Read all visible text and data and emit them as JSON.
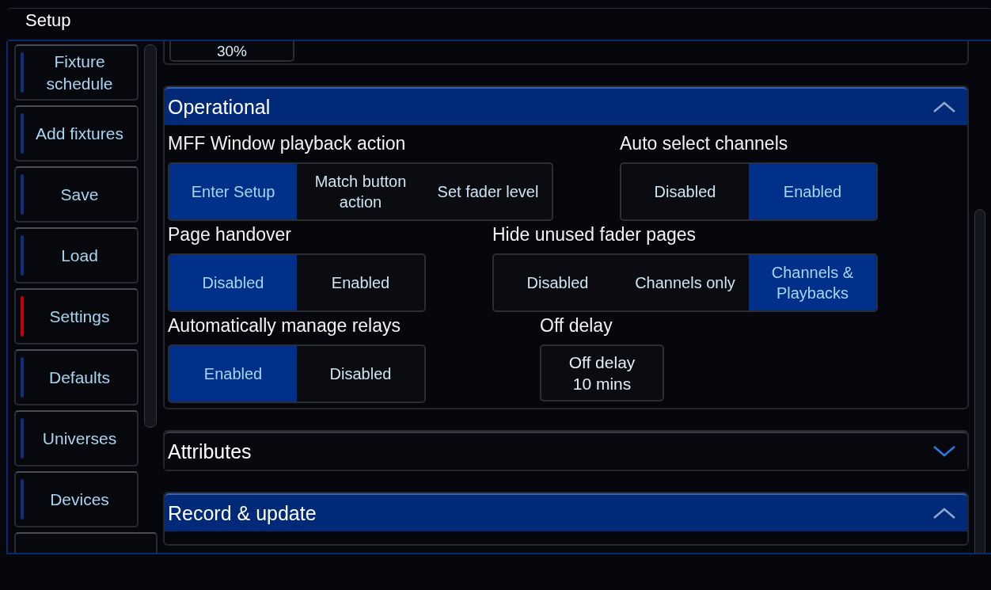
{
  "window": {
    "title": "Setup"
  },
  "sidebar": {
    "items": [
      {
        "label": "Fixture schedule",
        "selected": false
      },
      {
        "label": "Add fixtures",
        "selected": false
      },
      {
        "label": "Save",
        "selected": false
      },
      {
        "label": "Load",
        "selected": false
      },
      {
        "label": "Settings",
        "selected": true
      },
      {
        "label": "Defaults",
        "selected": false
      },
      {
        "label": "Universes",
        "selected": false
      },
      {
        "label": "Devices",
        "selected": false
      }
    ]
  },
  "sections": [
    {
      "kind": "partial",
      "value_button": "30%"
    },
    {
      "kind": "section",
      "title": "Operational",
      "expanded": true,
      "rows": [
        [
          {
            "label": "MFF Window playback action",
            "kind": "segmented",
            "options": [
              {
                "label": "Enter Setup",
                "selected": true
              },
              {
                "label": "Match button action",
                "selected": false
              },
              {
                "label": "Set fader level",
                "selected": false
              }
            ]
          },
          {
            "label": "Auto select channels",
            "kind": "segmented",
            "options": [
              {
                "label": "Disabled",
                "selected": false
              },
              {
                "label": "Enabled",
                "selected": true
              }
            ]
          }
        ],
        [
          {
            "label": "Page handover",
            "kind": "segmented",
            "options": [
              {
                "label": "Disabled",
                "selected": true
              },
              {
                "label": "Enabled",
                "selected": false
              }
            ]
          },
          {
            "label": "Hide unused fader pages",
            "kind": "segmented",
            "options": [
              {
                "label": "Disabled",
                "selected": false
              },
              {
                "label": "Channels only",
                "selected": false
              },
              {
                "label": "Channels & Playbacks",
                "selected": true
              }
            ]
          }
        ],
        [
          {
            "label": "Automatically manage relays",
            "kind": "segmented",
            "options": [
              {
                "label": "Enabled",
                "selected": true
              },
              {
                "label": "Disabled",
                "selected": false
              }
            ]
          },
          {
            "label": "Off delay",
            "kind": "button",
            "value": "Off delay 10 mins"
          }
        ]
      ]
    },
    {
      "kind": "section",
      "title": "Attributes",
      "expanded": false
    },
    {
      "kind": "section",
      "title": "Record & update",
      "expanded": true
    }
  ]
}
